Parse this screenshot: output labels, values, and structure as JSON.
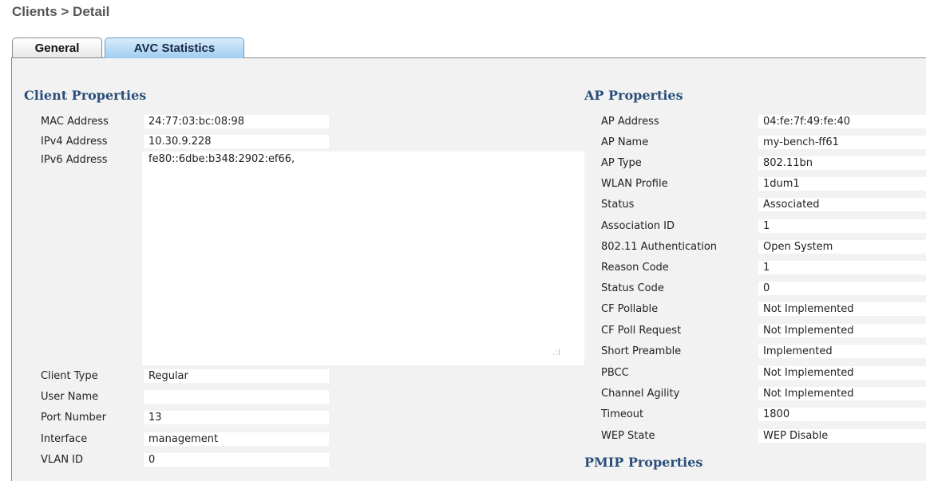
{
  "breadcrumb": "Clients > Detail",
  "tabs": [
    {
      "label": "General"
    },
    {
      "label": "AVC Statistics",
      "active": true
    }
  ],
  "client_properties": {
    "title": "Client Properties",
    "rows": [
      {
        "label": "MAC Address",
        "value": "24:77:03:bc:08:98"
      },
      {
        "label": "IPv4 Address",
        "value": "10.30.9.228"
      },
      {
        "label": "IPv6 Address",
        "value": "fe80::6dbe:b348:2902:ef66,"
      },
      {
        "label": "Client Type",
        "value": "Regular"
      },
      {
        "label": "User Name",
        "value": ""
      },
      {
        "label": "Port Number",
        "value": "13"
      },
      {
        "label": "Interface",
        "value": "management"
      },
      {
        "label": "VLAN ID",
        "value": "0"
      }
    ]
  },
  "ap_properties": {
    "title": "AP Properties",
    "rows": [
      {
        "label": "AP Address",
        "value": "04:fe:7f:49:fe:40"
      },
      {
        "label": "AP Name",
        "value": "my-bench-ff61"
      },
      {
        "label": "AP Type",
        "value": "802.11bn"
      },
      {
        "label": "WLAN Profile",
        "value": "1dum1"
      },
      {
        "label": "Status",
        "value": "Associated"
      },
      {
        "label": "Association ID",
        "value": "1"
      },
      {
        "label": "802.11 Authentication",
        "value": "Open System"
      },
      {
        "label": "Reason Code",
        "value": "1"
      },
      {
        "label": "Status Code",
        "value": "0"
      },
      {
        "label": "CF Pollable",
        "value": "Not Implemented"
      },
      {
        "label": "CF Poll Request",
        "value": "Not Implemented"
      },
      {
        "label": "Short Preamble",
        "value": "Implemented"
      },
      {
        "label": "PBCC",
        "value": "Not Implemented"
      },
      {
        "label": "Channel Agility",
        "value": "Not Implemented"
      },
      {
        "label": "Timeout",
        "value": "1800"
      },
      {
        "label": "WEP State",
        "value": "WEP Disable"
      }
    ]
  },
  "pmip_properties": {
    "title": "PMIP Properties"
  }
}
